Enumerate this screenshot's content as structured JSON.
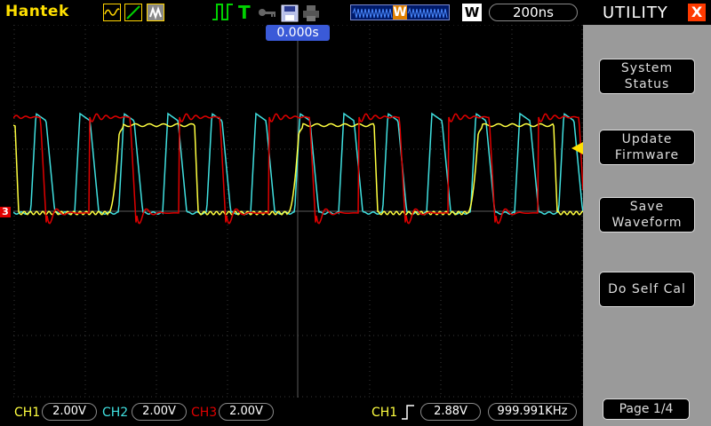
{
  "app": {
    "brand": "Hantek"
  },
  "status": {
    "time_base": "200ns",
    "acquisition_mode": "W",
    "memory_marker": "W",
    "time_position": "0.000s"
  },
  "panel": {
    "title": "UTILITY",
    "close_label": "X",
    "buttons": [
      {
        "label": "System\nStatus"
      },
      {
        "label": "Update\nFirmware"
      },
      {
        "label": "Save\nWaveform"
      },
      {
        "label": "Do Self Cal"
      }
    ],
    "page": "Page 1/4"
  },
  "channels": {
    "ch1": {
      "label": "CH1",
      "scale": "2.00V",
      "color": "#ffff40"
    },
    "ch2": {
      "label": "CH2",
      "scale": "2.00V",
      "color": "#40e0e0"
    },
    "ch3": {
      "label": "CH3",
      "scale": "2.00V",
      "color": "#e00000",
      "marker": "3"
    }
  },
  "trigger": {
    "source": "CH1",
    "level": "2.88V",
    "frequency": "999.991KHz"
  },
  "colors": {
    "accent_yellow": "#ffe000",
    "panel_gray": "#9a9a9a",
    "close_red": "#ff3a00",
    "timepos_blue": "#3a5ad8"
  }
}
